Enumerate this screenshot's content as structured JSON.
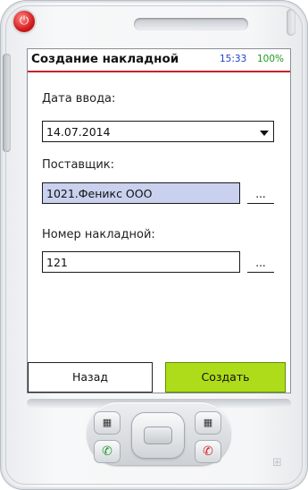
{
  "device": {
    "power_icon": "power-icon",
    "call_icon": "call-icon",
    "end_call_icon": "end-call-icon",
    "left_softkey_icon": "softkey-icon",
    "right_softkey_icon": "softkey-icon",
    "windows_logo_icon": "windows-logo-icon"
  },
  "titlebar": {
    "title": "Создание накладной",
    "clock": "15:33",
    "battery": "100%",
    "accent_color": "#c8202a"
  },
  "form": {
    "date_label": "Дата ввода:",
    "date_value": "14.07.2014",
    "supplier_label": "Поставщик:",
    "supplier_value": "1021.Феникс ООО",
    "supplier_button": "...",
    "invoice_label": "Номер накладной:",
    "invoice_value": "121",
    "invoice_button": "..."
  },
  "buttons": {
    "back": "Назад",
    "create": "Создать",
    "create_color": "#aedc1a"
  }
}
